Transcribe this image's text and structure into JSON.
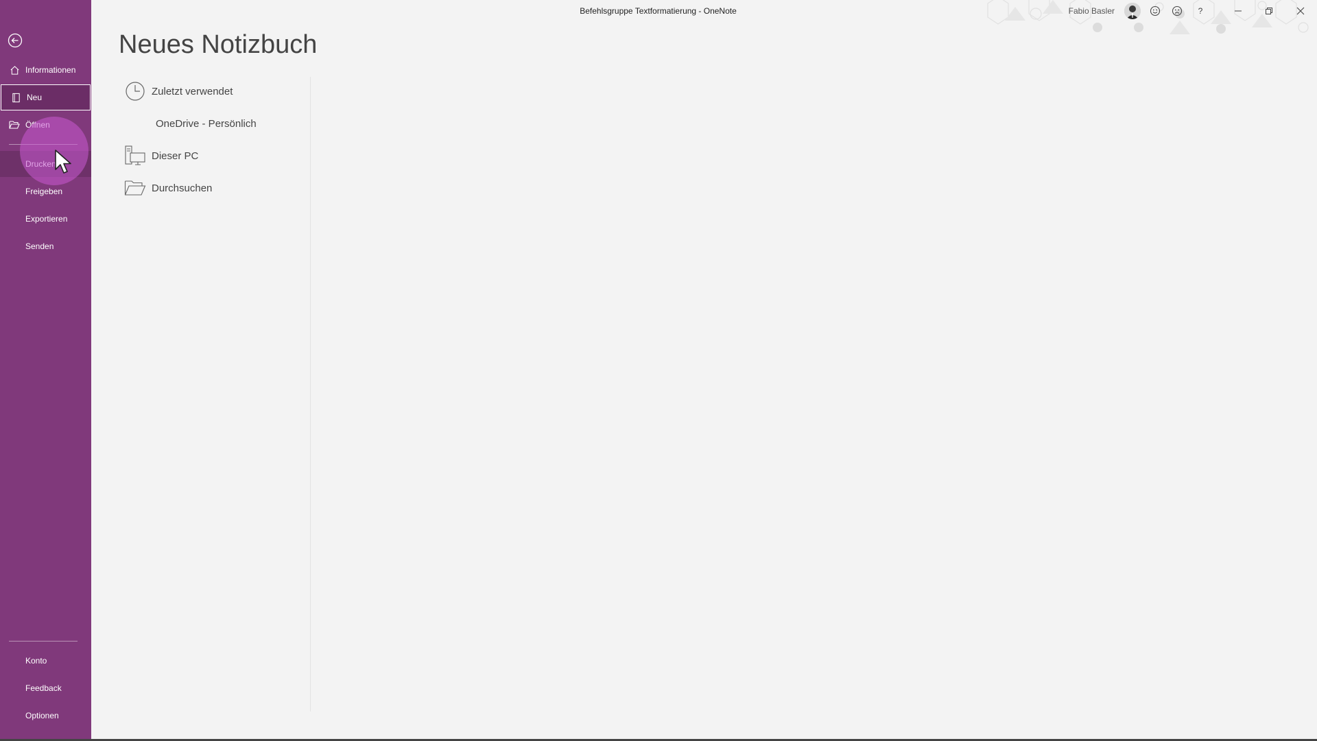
{
  "window": {
    "title": "Befehlsgruppe Textformatierung  -  OneNote",
    "user_name": "Fabio Basler",
    "help_label": "?"
  },
  "sidebar": {
    "items": [
      {
        "label": "Informationen",
        "icon": "home-icon"
      },
      {
        "label": "Neu",
        "icon": "notebook-icon",
        "selected": true
      },
      {
        "label": "Öffnen",
        "icon": "folder-open-icon"
      },
      {
        "label": "Drucken"
      },
      {
        "label": "Freigeben"
      },
      {
        "label": "Exportieren"
      },
      {
        "label": "Senden"
      }
    ],
    "footer_items": [
      {
        "label": "Konto"
      },
      {
        "label": "Feedback"
      },
      {
        "label": "Optionen"
      }
    ]
  },
  "main": {
    "title": "Neues Notizbuch",
    "locations": [
      {
        "label": "Zuletzt verwendet",
        "icon": "clock-icon"
      },
      {
        "label": "OneDrive - Persönlich"
      },
      {
        "label": "Dieser PC",
        "icon": "computer-icon"
      },
      {
        "label": "Durchsuchen",
        "icon": "folder-icon"
      }
    ]
  },
  "colors": {
    "sidebar_bg": "#80397b",
    "selected_bg": "#6b2d66",
    "content_bg": "#f3f3f3"
  }
}
